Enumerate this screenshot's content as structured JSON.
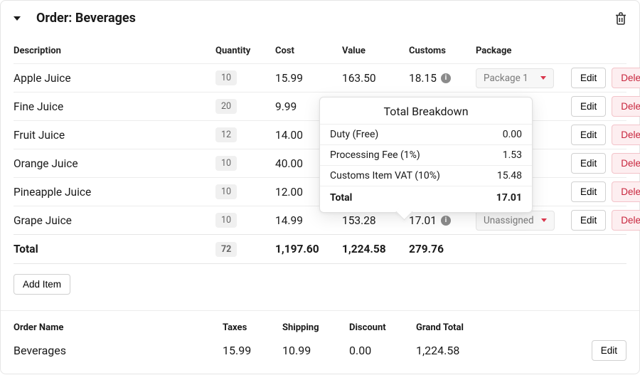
{
  "header": {
    "title": "Order: Beverages"
  },
  "columns": {
    "description": "Description",
    "quantity": "Quantity",
    "cost": "Cost",
    "value": "Value",
    "customs": "Customs",
    "package": "Package"
  },
  "labels": {
    "edit": "Edit",
    "delete": "Delete",
    "add_item": "Add Item",
    "total": "Total"
  },
  "rows": [
    {
      "description": "Apple Juice",
      "quantity": "10",
      "cost": "15.99",
      "value": "163.50",
      "customs": "18.15",
      "package": "Package 1"
    },
    {
      "description": "Fine Juice",
      "quantity": "20",
      "cost": "9.99",
      "value": "",
      "customs": "",
      "package": ""
    },
    {
      "description": "Fruit Juice",
      "quantity": "12",
      "cost": "14.00",
      "value": "",
      "customs": "",
      "package": ""
    },
    {
      "description": "Orange Juice",
      "quantity": "10",
      "cost": "40.00",
      "value": "",
      "customs": "",
      "package": ""
    },
    {
      "description": "Pineapple Juice",
      "quantity": "10",
      "cost": "12.00",
      "value": "",
      "customs": "",
      "package": ""
    },
    {
      "description": "Grape Juice",
      "quantity": "10",
      "cost": "14.99",
      "value": "153.28",
      "customs": "17.01",
      "package": "Unassigned"
    }
  ],
  "totals": {
    "quantity": "72",
    "cost": "1,197.60",
    "value": "1,224.58",
    "customs": "279.76"
  },
  "popover": {
    "title": "Total Breakdown",
    "rows": [
      {
        "label": "Duty (Free)",
        "value": "0.00"
      },
      {
        "label": "Processing Fee (1%)",
        "value": "1.53"
      },
      {
        "label": "Customs Item VAT (10%)",
        "value": "15.48"
      }
    ],
    "total_label": "Total",
    "total_value": "17.01"
  },
  "footer": {
    "labels": {
      "order_name": "Order Name",
      "taxes": "Taxes",
      "shipping": "Shipping",
      "discount": "Discount",
      "grand_total": "Grand Total"
    },
    "values": {
      "order_name": "Beverages",
      "taxes": "15.99",
      "shipping": "10.99",
      "discount": "0.00",
      "grand_total": "1,224.58"
    },
    "edit": "Edit"
  }
}
